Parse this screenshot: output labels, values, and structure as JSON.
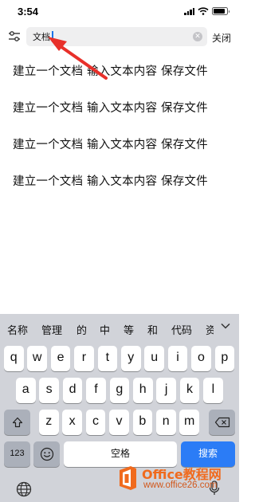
{
  "status_bar": {
    "time": "3:54",
    "icons": [
      "signal-icon",
      "wifi-icon",
      "battery-icon"
    ],
    "battery_level": 0.9
  },
  "search": {
    "query": "文档",
    "close_label": "关闭",
    "icons": [
      "filter-icon",
      "clear-icon"
    ]
  },
  "results": [
    "建立一个文档  输入文本内容  保存文件",
    "建立一个文档  输入文本内容  保存文件",
    "建立一个文档  输入文本内容  保存文件",
    "建立一个文档  输入文本内容  保存文件"
  ],
  "keyboard": {
    "suggestions": [
      "名称",
      "管理",
      "的",
      "中",
      "等",
      "和",
      "代码",
      "资"
    ],
    "row1": [
      "q",
      "w",
      "e",
      "r",
      "t",
      "y",
      "u",
      "i",
      "o",
      "p"
    ],
    "row2": [
      "a",
      "s",
      "d",
      "f",
      "g",
      "h",
      "j",
      "k",
      "l"
    ],
    "row3": [
      "z",
      "x",
      "c",
      "v",
      "b",
      "n",
      "m"
    ],
    "numbers_label": "123",
    "space_label": "空格",
    "search_label": "搜索",
    "icons": [
      "shift-icon",
      "delete-icon",
      "emoji-icon",
      "globe-icon",
      "microphone-icon",
      "chevron-down-icon"
    ],
    "colors": {
      "background": "#d1d3d9",
      "search_key": "#2b7cf6"
    }
  },
  "watermark": {
    "title": "Office教程网",
    "url": "www.office26.com",
    "color": "#f06a1d"
  },
  "annotation": {
    "type": "red-arrow",
    "color": "#e8302a"
  }
}
